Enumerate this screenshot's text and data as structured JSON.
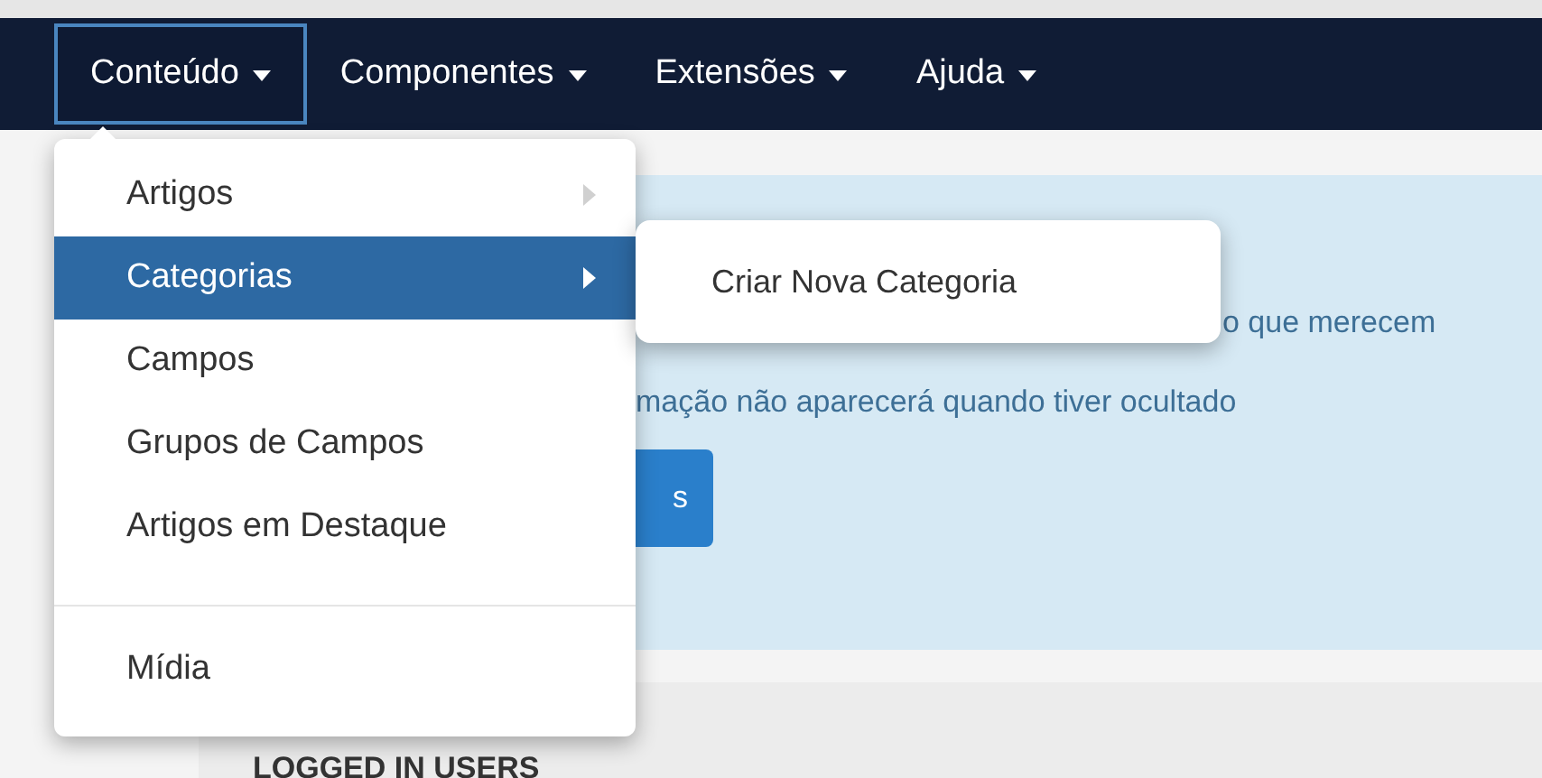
{
  "navbar": {
    "items": [
      {
        "label": "Conteúdo",
        "selected": true
      },
      {
        "label": "Componentes",
        "selected": false
      },
      {
        "label": "Extensões",
        "selected": false
      },
      {
        "label": "Ajuda",
        "selected": false
      }
    ]
  },
  "dropdown": {
    "groups": [
      [
        {
          "label": "Artigos",
          "has_submenu": true,
          "selected": false
        },
        {
          "label": "Categorias",
          "has_submenu": true,
          "selected": true
        },
        {
          "label": "Campos",
          "has_submenu": false,
          "selected": false
        },
        {
          "label": "Grupos de Campos",
          "has_submenu": false,
          "selected": false
        },
        {
          "label": "Artigos em Destaque",
          "has_submenu": false,
          "selected": false
        }
      ],
      [
        {
          "label": "Mídia",
          "has_submenu": false,
          "selected": false
        }
      ]
    ]
  },
  "submenu": {
    "items": [
      "Criar Nova Categoria"
    ]
  },
  "alert": {
    "lines": [
      "o que merecem",
      "mação não aparecerá quando tiver ocultado"
    ],
    "button": "s"
  },
  "panel": {
    "title": "LOGGED IN USERS"
  }
}
